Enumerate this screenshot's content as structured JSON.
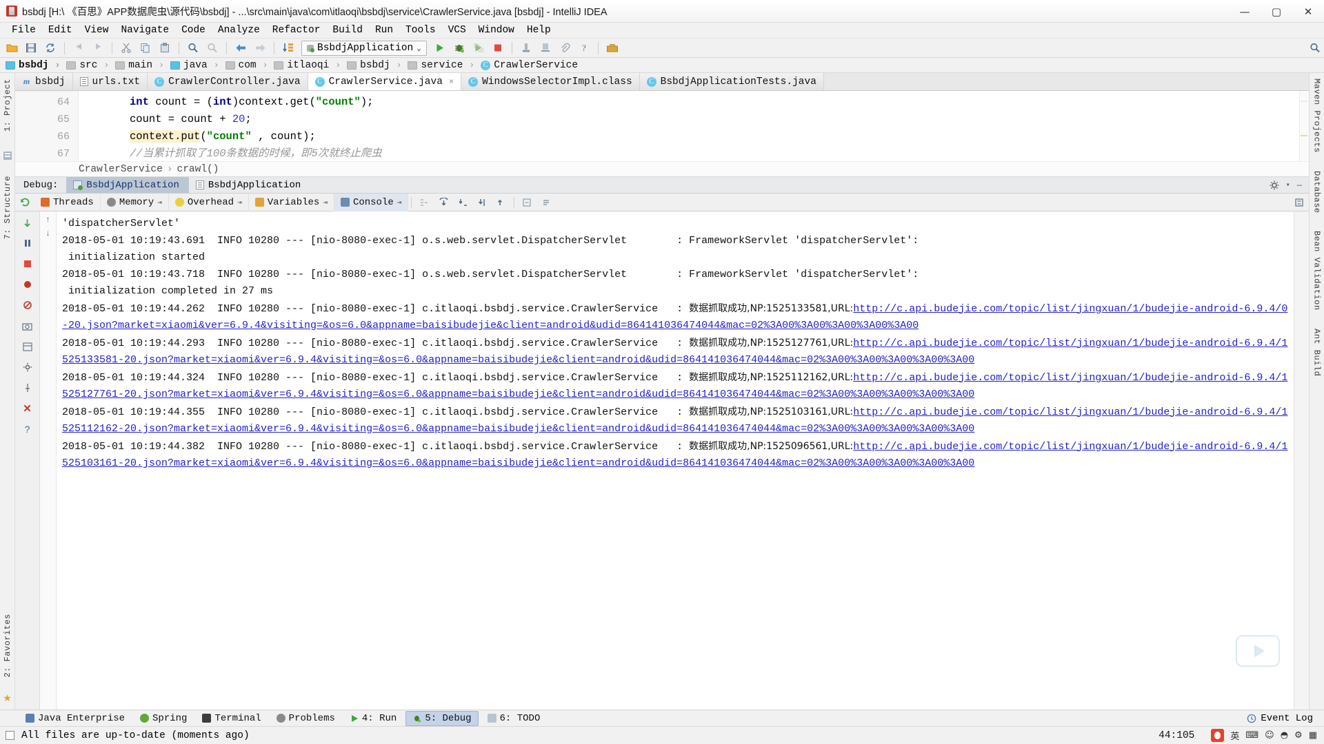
{
  "window": {
    "title": "bsbdj [H:\\ 《百思》APP数据爬虫\\源代码\\bsbdj] - ...\\src\\main\\java\\com\\itlaoqi\\bsbdj\\service\\CrawlerService.java [bsbdj] - IntelliJ IDEA",
    "minimize": "—",
    "maximize": "▢",
    "close": "✕"
  },
  "menu": [
    "File",
    "Edit",
    "View",
    "Navigate",
    "Code",
    "Analyze",
    "Refactor",
    "Build",
    "Run",
    "Tools",
    "VCS",
    "Window",
    "Help"
  ],
  "toolbar": {
    "run_configuration": "BsbdjApplication",
    "caret": "⌄",
    "icons": [
      "open-folder",
      "save-all",
      "sync",
      "undo",
      "redo",
      "cut",
      "copy",
      "paste",
      "find",
      "find-replace",
      "back",
      "forward",
      "compile",
      "run",
      "debug",
      "run-coverage",
      "stop",
      "profile",
      "help",
      "toolbox",
      "search-everywhere"
    ]
  },
  "breadcrumb": [
    {
      "label": "bsbdj",
      "icon": "module-folder-icon"
    },
    {
      "label": "src",
      "icon": "folder-icon"
    },
    {
      "label": "main",
      "icon": "folder-icon"
    },
    {
      "label": "java",
      "icon": "source-folder-icon"
    },
    {
      "label": "com",
      "icon": "package-icon"
    },
    {
      "label": "itlaoqi",
      "icon": "package-icon"
    },
    {
      "label": "bsbdj",
      "icon": "package-icon"
    },
    {
      "label": "service",
      "icon": "package-icon"
    },
    {
      "label": "CrawlerService",
      "icon": "class-icon"
    }
  ],
  "editor_tabs": [
    {
      "label": "bsbdj",
      "icon": "module-icon",
      "active": false,
      "closable": false
    },
    {
      "label": "urls.txt",
      "icon": "text-file-icon",
      "active": false,
      "closable": false
    },
    {
      "label": "CrawlerController.java",
      "icon": "class-icon",
      "active": false,
      "closable": false
    },
    {
      "label": "CrawlerService.java",
      "icon": "class-icon",
      "active": true,
      "closable": true
    },
    {
      "label": "WindowsSelectorImpl.class",
      "icon": "class-icon",
      "active": false,
      "closable": false
    },
    {
      "label": "BsbdjApplicationTests.java",
      "icon": "class-icon",
      "active": false,
      "closable": false
    }
  ],
  "tab_close_glyph": "×",
  "code": {
    "line_numbers": [
      "64",
      "65",
      "66",
      "67"
    ],
    "lines": [
      {
        "segments": [
          {
            "t": "int",
            "c": "kw"
          },
          {
            "t": " count = (",
            "c": ""
          },
          {
            "t": "int",
            "c": "kw"
          },
          {
            "t": ")context.get(",
            "c": ""
          },
          {
            "t": "\"count\"",
            "c": "str"
          },
          {
            "t": ");",
            "c": ""
          }
        ]
      },
      {
        "segments": [
          {
            "t": "count = count + ",
            "c": ""
          },
          {
            "t": "20",
            "c": "num"
          },
          {
            "t": ";",
            "c": ""
          }
        ]
      },
      {
        "segments": [
          {
            "t": "context.put",
            "c": "hl"
          },
          {
            "t": "(",
            "c": ""
          },
          {
            "t": "\"count\"",
            "c": "str"
          },
          {
            "t": " , count);",
            "c": ""
          }
        ]
      },
      {
        "segments": [
          {
            "t": "//当累计抓取了100条数据的时候，即5次就终止爬虫",
            "c": "cmt"
          }
        ]
      }
    ]
  },
  "editor_breadcrumb": {
    "class": "CrawlerService",
    "separator": "›",
    "method": "crawl()"
  },
  "debug": {
    "label": "Debug:",
    "tabs": [
      {
        "label": "BsbdjApplication",
        "active": true
      },
      {
        "label": "BsbdjApplication",
        "active": false
      }
    ],
    "settings_icon": "gear-icon",
    "minimize_icon": "minimize-icon",
    "panes": [
      {
        "label": "Threads",
        "icon": "threads-icon",
        "selected": false,
        "pin": "⇥"
      },
      {
        "label": "Memory",
        "icon": "memory-icon",
        "selected": false,
        "pin": "⇥"
      },
      {
        "label": "Overhead",
        "icon": "overhead-icon",
        "selected": false,
        "pin": "⇥"
      },
      {
        "label": "Variables",
        "icon": "variables-icon",
        "selected": false,
        "pin": "⇥"
      },
      {
        "label": "Console",
        "icon": "console-icon",
        "selected": true,
        "pin": "⇥"
      }
    ],
    "step_buttons": [
      "show-execution-point",
      "step-over",
      "step-into",
      "force-step-into",
      "step-out",
      "drop-frame",
      "evaluate-expression"
    ],
    "side_buttons": [
      "rerun",
      "resume",
      "pause",
      "stop",
      "view-breakpoints",
      "mute-breakpoints",
      "settings",
      "layout",
      "pin",
      "close",
      "help"
    ],
    "scroll_buttons": [
      "scroll-up",
      "scroll-down"
    ]
  },
  "console": {
    "lines": [
      {
        "type": "plain",
        "text": "'dispatcherServlet'"
      },
      {
        "type": "plain",
        "text": "2018-05-01 10:19:43.691  INFO 10280 --- [nio-8080-exec-1] o.s.web.servlet.DispatcherServlet        : FrameworkServlet 'dispatcherServlet':"
      },
      {
        "type": "plain",
        "text": " initialization started"
      },
      {
        "type": "plain",
        "text": "2018-05-01 10:19:43.718  INFO 10280 --- [nio-8080-exec-1] o.s.web.servlet.DispatcherServlet        : FrameworkServlet 'dispatcherServlet':"
      },
      {
        "type": "plain",
        "text": " initialization completed in 27 ms"
      },
      {
        "type": "entry",
        "prefix": "2018-05-01 10:19:44.262  INFO 10280 --- [nio-8080-exec-1] c.itlaoqi.bsbdj.service.CrawlerService   : ",
        "cn": "数据抓取成功,NP:1525133581,URL:",
        "url": "http://c.api.budejie.com/topic/list/jingxuan/1/budejie-android-6.9.4/0-20.json?market=xiaomi&ver=6.9.4&visiting=&os=6.0&appname=baisibudejie&client=android&udid=864141036474044&mac=02%3A00%3A00%3A00%3A00%3A00"
      },
      {
        "type": "entry",
        "prefix": "2018-05-01 10:19:44.293  INFO 10280 --- [nio-8080-exec-1] c.itlaoqi.bsbdj.service.CrawlerService   : ",
        "cn": "数据抓取成功,NP:1525127761,URL:",
        "url": "http://c.api.budejie.com/topic/list/jingxuan/1/budejie-android-6.9.4/1525133581-20.json?market=xiaomi&ver=6.9.4&visiting=&os=6.0&appname=baisibudejie&client=android&udid=864141036474044&mac=02%3A00%3A00%3A00%3A00%3A00"
      },
      {
        "type": "entry",
        "prefix": "2018-05-01 10:19:44.324  INFO 10280 --- [nio-8080-exec-1] c.itlaoqi.bsbdj.service.CrawlerService   : ",
        "cn": "数据抓取成功,NP:1525112162,URL:",
        "url": "http://c.api.budejie.com/topic/list/jingxuan/1/budejie-android-6.9.4/1525127761-20.json?market=xiaomi&ver=6.9.4&visiting=&os=6.0&appname=baisibudejie&client=android&udid=864141036474044&mac=02%3A00%3A00%3A00%3A00%3A00"
      },
      {
        "type": "entry",
        "prefix": "2018-05-01 10:19:44.355  INFO 10280 --- [nio-8080-exec-1] c.itlaoqi.bsbdj.service.CrawlerService   : ",
        "cn": "数据抓取成功,NP:1525103161,URL:",
        "url": "http://c.api.budejie.com/topic/list/jingxuan/1/budejie-android-6.9.4/1525112162-20.json?market=xiaomi&ver=6.9.4&visiting=&os=6.0&appname=baisibudejie&client=android&udid=864141036474044&mac=02%3A00%3A00%3A00%3A00%3A00"
      },
      {
        "type": "entry",
        "prefix": "2018-05-01 10:19:44.382  INFO 10280 --- [nio-8080-exec-1] c.itlaoqi.bsbdj.service.CrawlerService   : ",
        "cn": "数据抓取成功,NP:1525096561,URL:",
        "url": "http://c.api.budejie.com/topic/list/jingxuan/1/budejie-android-6.9.4/1525103161-20.json?market=xiaomi&ver=6.9.4&visiting=&os=6.0&appname=baisibudejie&client=android&udid=864141036474044&mac=02%3A00%3A00%3A00%3A00%3A00"
      }
    ]
  },
  "left_rail": [
    "1: Project",
    "7: Structure",
    "2: Favorites"
  ],
  "right_rail": [
    "Maven Projects",
    "Database",
    "Bean Validation",
    "Ant Build"
  ],
  "bottom_tools": [
    {
      "label": "Java Enterprise",
      "icon": "java-enterprise-icon",
      "selected": false
    },
    {
      "label": "Spring",
      "icon": "spring-icon",
      "selected": false
    },
    {
      "label": "Terminal",
      "icon": "terminal-icon",
      "selected": false
    },
    {
      "label": "Problems",
      "icon": "problems-icon",
      "selected": false
    },
    {
      "label": "4: Run",
      "icon": "run-icon",
      "selected": false
    },
    {
      "label": "5: Debug",
      "icon": "debug-icon",
      "selected": true
    },
    {
      "label": "6: TODO",
      "icon": "todo-icon",
      "selected": false
    }
  ],
  "event_log": {
    "label": "Event Log",
    "icon": "event-log-icon"
  },
  "status": {
    "message": "All files are up-to-date (moments ago)",
    "caret_position": "44:105",
    "tray": [
      "sogou-input-icon",
      "英",
      "keyboard-icon",
      "smiley-icon",
      "circle-icon",
      "settings-icon",
      "image-icon"
    ]
  },
  "colors": {
    "accent_blue": "#2222cc",
    "keyword": "#000080",
    "string": "#008000",
    "number": "#3232c8",
    "comment": "#969696",
    "highlight": "#fdf2cc",
    "selection": "#bcc7d4"
  }
}
